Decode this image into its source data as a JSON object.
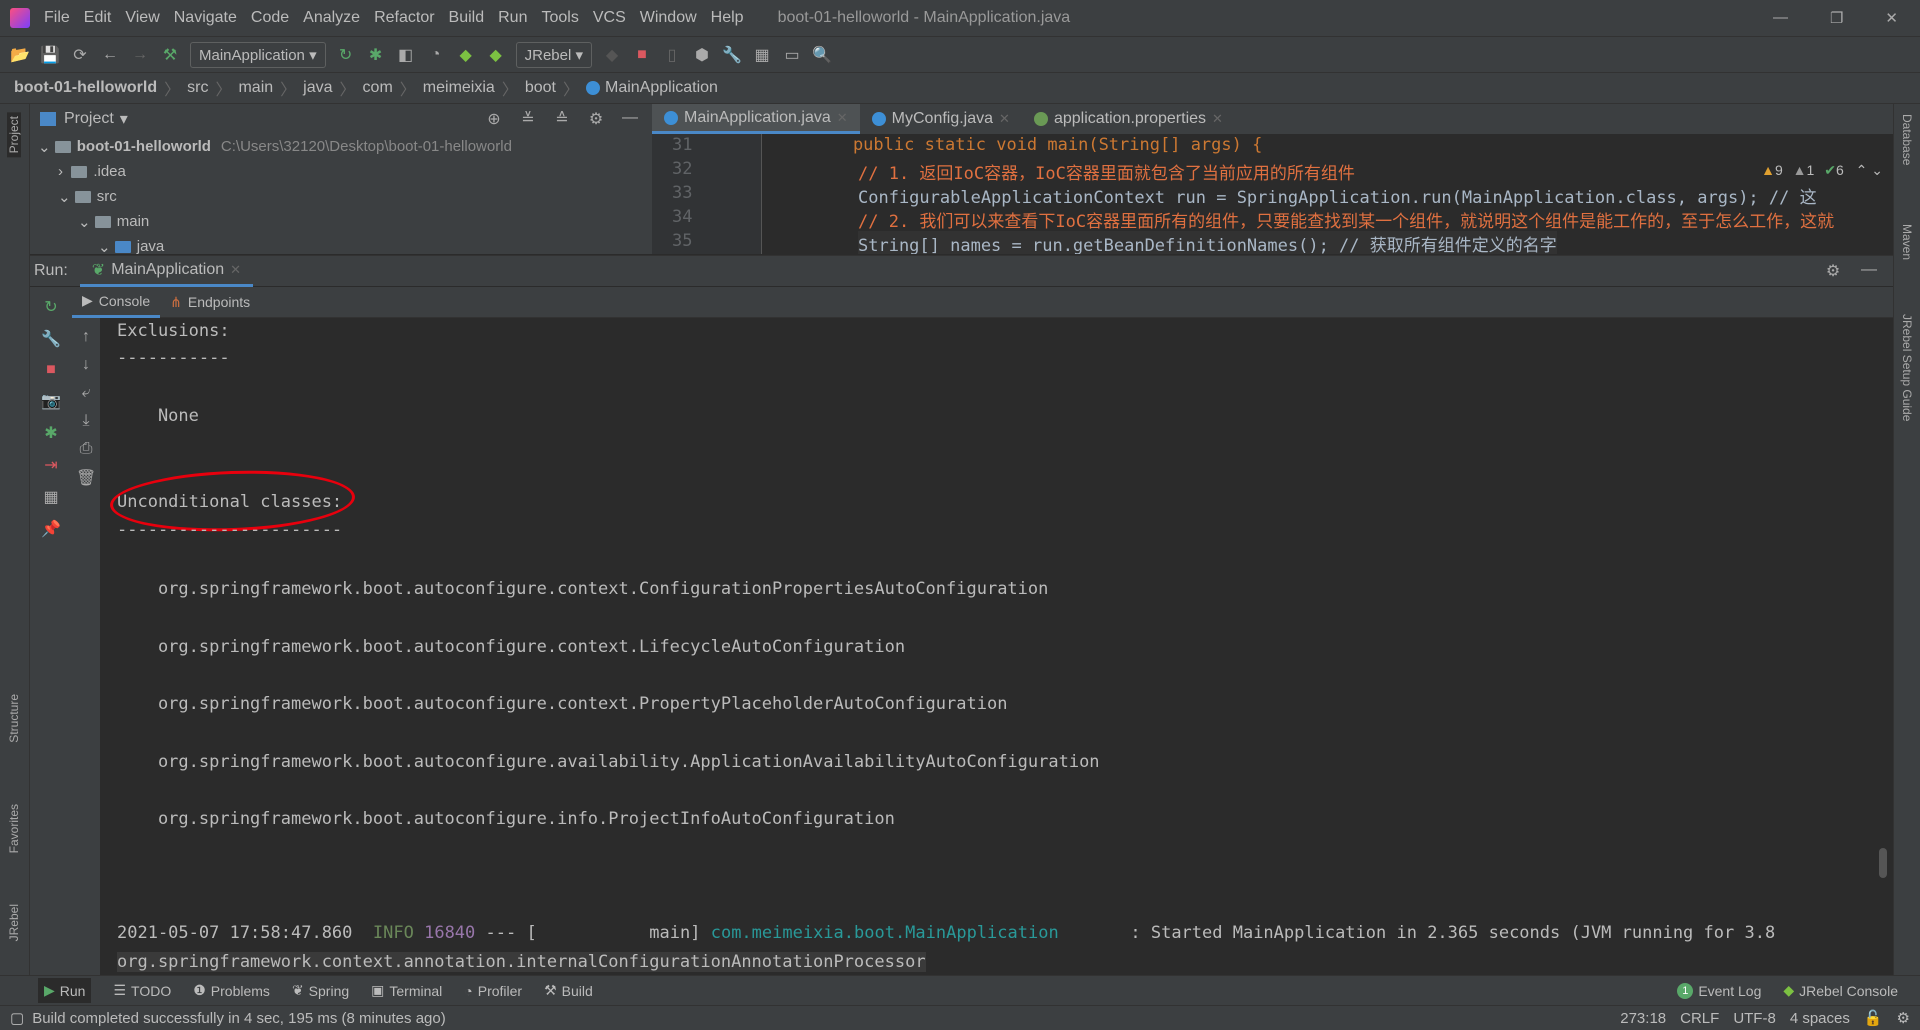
{
  "menu": {
    "items": [
      "File",
      "Edit",
      "View",
      "Navigate",
      "Code",
      "Analyze",
      "Refactor",
      "Build",
      "Run",
      "Tools",
      "VCS",
      "Window",
      "Help"
    ],
    "window_title": "boot-01-helloworld - MainApplication.java"
  },
  "toolbar": {
    "run_config": "MainApplication",
    "jrebel": "JRebel"
  },
  "breadcrumb": [
    "boot-01-helloworld",
    "src",
    "main",
    "java",
    "com",
    "meimeixia",
    "boot",
    "MainApplication"
  ],
  "project": {
    "title": "Project",
    "root": "boot-01-helloworld",
    "root_path": "C:\\Users\\32120\\Desktop\\boot-01-helloworld",
    "items": [
      ".idea",
      "src",
      "main",
      "java"
    ]
  },
  "editor": {
    "tabs": [
      "MainApplication.java",
      "MyConfig.java",
      "application.properties"
    ],
    "inspections": {
      "warnings": "9",
      "weak_warnings": "1",
      "ok": "6"
    },
    "lines": [
      {
        "n": "31",
        "text": "    public static void main(String[] args) {"
      },
      {
        "n": "32",
        "text": "// 1. 返回IoC容器，IoC容器里面就包含了当前应用的所有组件"
      },
      {
        "n": "33",
        "text": "ConfigurableApplicationContext run = SpringApplication.run(MainApplication.class, args); // 这"
      },
      {
        "n": "34",
        "text": "// 2. 我们可以来查看下IoC容器里面所有的组件，只要能查找到某一个组件，就说明这个组件是能工作的，至于怎么工作，这就"
      },
      {
        "n": "35",
        "text": "String[] names = run.getBeanDefinitionNames(); // 获取所有组件定义的名字"
      }
    ]
  },
  "run": {
    "label": "Run:",
    "tab": "MainApplication",
    "subtabs": [
      "Console",
      "Endpoints"
    ]
  },
  "console": {
    "lines": [
      "Exclusions:",
      "-----------",
      "    None",
      "Unconditional classes:",
      "----------------------",
      "    org.springframework.boot.autoconfigure.context.ConfigurationPropertiesAutoConfiguration",
      "    org.springframework.boot.autoconfigure.context.LifecycleAutoConfiguration",
      "    org.springframework.boot.autoconfigure.context.PropertyPlaceholderAutoConfiguration",
      "    org.springframework.boot.autoconfigure.availability.ApplicationAvailabilityAutoConfiguration",
      "    org.springframework.boot.autoconfigure.info.ProjectInfoAutoConfiguration"
    ],
    "log": {
      "timestamp": "2021-05-07 17:58:47.860",
      "level": "INFO",
      "pid": "16840",
      "sep": "--- [           main]",
      "logger": "com.meimeixia.boot.MainApplication",
      "message": "      : Started MainApplication in 2.365 seconds (JVM running for 3.8"
    },
    "last_line": "org.springframework.context.annotation.internalConfigurationAnnotationProcessor"
  },
  "side": {
    "left": [
      "Project",
      "Structure",
      "Favorites",
      "JRebel"
    ],
    "right": [
      "Database",
      "Maven",
      "JRebel Setup Guide"
    ]
  },
  "bottom_tools": [
    "Run",
    "TODO",
    "Problems",
    "Spring",
    "Terminal",
    "Profiler",
    "Build"
  ],
  "bottom_right": {
    "event_log": "Event Log",
    "event_count": "1",
    "jrebel_console": "JRebel Console"
  },
  "status": {
    "message": "Build completed successfully in 4 sec, 195 ms (8 minutes ago)",
    "position": "273:18",
    "line_sep": "CRLF",
    "encoding": "UTF-8",
    "indent": "4 spaces"
  }
}
